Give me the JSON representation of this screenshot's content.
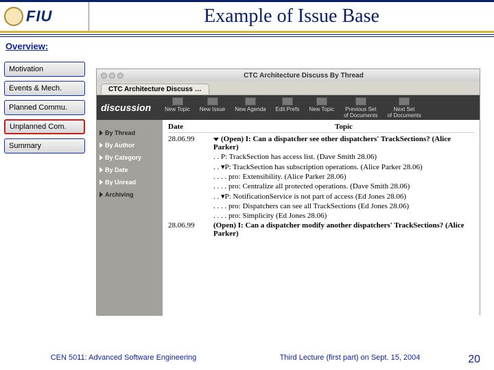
{
  "slide": {
    "title": "Example of Issue Base",
    "overview_label": "Overview:",
    "nav": [
      {
        "label": "Motivation",
        "active": false
      },
      {
        "label": "Events & Mech.",
        "active": false
      },
      {
        "label": "Planned Commu.",
        "active": false
      },
      {
        "label": "Unplanned Com.",
        "active": true
      },
      {
        "label": "Summary",
        "active": false
      }
    ],
    "logo_text": "FIU"
  },
  "screenshot": {
    "window_title": "CTC Architecture Discuss By Thread",
    "tab_label": "CTC Architecture Discuss …",
    "brand": "discussion",
    "toolbar_buttons": [
      "New Topic",
      "New Issue",
      "New Agenda",
      "Edit Prefs",
      "New Topic",
      "Previous Set\nof Documents",
      "Next Set\nof Documents"
    ],
    "sidebar": [
      {
        "label": "By Thread",
        "dark": true
      },
      {
        "label": "By Author",
        "dark": false
      },
      {
        "label": "By Category",
        "dark": false
      },
      {
        "label": "By Date",
        "dark": false
      },
      {
        "label": "By Unread",
        "dark": false
      },
      {
        "label": "Archiving",
        "dark": true
      }
    ],
    "headers": {
      "date": "Date",
      "topic": "Topic"
    },
    "threads": [
      {
        "date": "28.06.99",
        "indent": 0,
        "arrow": true,
        "text": "(Open) I: Can a dispatcher see other dispatchers' TrackSections? (Alice Parker)"
      },
      {
        "date": "",
        "indent": 1,
        "arrow": false,
        "text": ". .  P: TrackSection has access list. (Dave Smith 28.06)"
      },
      {
        "date": "",
        "indent": 1,
        "arrow": true,
        "text": ". . ▾P: TrackSection has subscription operations. (Alice Parker 28.06)"
      },
      {
        "date": "",
        "indent": 2,
        "arrow": false,
        "text": ". . . .  pro: Extensibility. (Alice Parker 28.06)"
      },
      {
        "date": "",
        "indent": 2,
        "arrow": false,
        "text": ". . . .  pro: Centralize all protected operations. (Dave Smith 28.06)"
      },
      {
        "date": "",
        "indent": 1,
        "arrow": true,
        "text": ". . ▾P: NotificationService is not part of access (Ed Jones 28.06)"
      },
      {
        "date": "",
        "indent": 2,
        "arrow": false,
        "text": ". . . .  pro: Dispatchers can see all TrackSections (Ed Jones 28.06)"
      },
      {
        "date": "",
        "indent": 2,
        "arrow": false,
        "text": ". . . .  pro: Simplicity (Ed Jones 28.06)"
      },
      {
        "date": "28.06.99",
        "indent": 0,
        "arrow": false,
        "text": "(Open) I: Can a dispatcher modify another dispatchers' TrackSections? (Alice Parker)"
      }
    ]
  },
  "footer": {
    "course": "CEN 5011: Advanced Software Engineering",
    "lecture": "Third Lecture (first part) on Sept. 15, 2004",
    "page": "20"
  }
}
